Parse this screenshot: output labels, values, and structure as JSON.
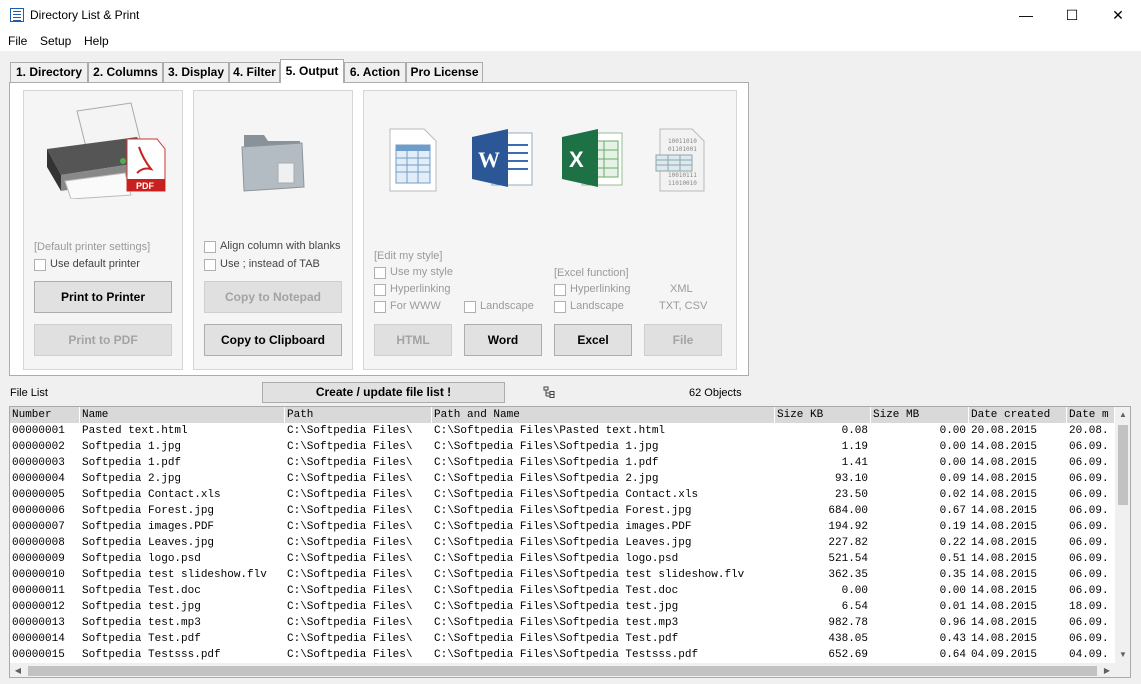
{
  "window": {
    "title": "Directory List & Print"
  },
  "menu": [
    "File",
    "Setup",
    "Help"
  ],
  "tabs": [
    "1. Directory",
    "2. Columns",
    "3. Display",
    "4. Filter",
    "5. Output",
    "6. Action",
    "Pro License"
  ],
  "active_tab": 4,
  "print_group": {
    "settings_label": "[Default printer settings]",
    "use_default_printer": "Use default printer",
    "print_button": "Print to Printer",
    "pdf_button": "Print to PDF"
  },
  "clipboard_group": {
    "align_blanks": "Align column with blanks",
    "use_tab": "Use  ;  instead of TAB",
    "notepad_button": "Copy to Notepad",
    "clipboard_button": "Copy to Clipboard"
  },
  "export_group": {
    "edit_style": "[Edit my style]",
    "use_my_style": "Use my style",
    "hyperlinking": "Hyperlinking",
    "for_www": "For WWW",
    "landscape_word": "Landscape",
    "excel_function": "[Excel function]",
    "excel_hyperlinking": "Hyperlinking",
    "excel_landscape": "Landscape",
    "xml": "XML",
    "txt_csv": "TXT, CSV",
    "html_button": "HTML",
    "word_button": "Word",
    "excel_button": "Excel",
    "file_button": "File"
  },
  "file_list": {
    "label": "File List",
    "create_button": "Create / update file list !",
    "object_count": "62 Objects"
  },
  "grid": {
    "columns": [
      "Number",
      "Name",
      "Path",
      "Path and Name",
      "Size KB",
      "Size MB",
      "Date created",
      "Date m"
    ],
    "rows": [
      [
        "00000001",
        "Pasted text.html",
        "C:\\Softpedia Files\\",
        "C:\\Softpedia Files\\Pasted text.html",
        "0.08",
        "0.00",
        "20.08.2015",
        "20.08."
      ],
      [
        "00000002",
        "Softpedia 1.jpg",
        "C:\\Softpedia Files\\",
        "C:\\Softpedia Files\\Softpedia 1.jpg",
        "1.19",
        "0.00",
        "14.08.2015",
        "06.09."
      ],
      [
        "00000003",
        "Softpedia 1.pdf",
        "C:\\Softpedia Files\\",
        "C:\\Softpedia Files\\Softpedia 1.pdf",
        "1.41",
        "0.00",
        "14.08.2015",
        "06.09."
      ],
      [
        "00000004",
        "Softpedia 2.jpg",
        "C:\\Softpedia Files\\",
        "C:\\Softpedia Files\\Softpedia 2.jpg",
        "93.10",
        "0.09",
        "14.08.2015",
        "06.09."
      ],
      [
        "00000005",
        "Softpedia Contact.xls",
        "C:\\Softpedia Files\\",
        "C:\\Softpedia Files\\Softpedia Contact.xls",
        "23.50",
        "0.02",
        "14.08.2015",
        "06.09."
      ],
      [
        "00000006",
        "Softpedia Forest.jpg",
        "C:\\Softpedia Files\\",
        "C:\\Softpedia Files\\Softpedia Forest.jpg",
        "684.00",
        "0.67",
        "14.08.2015",
        "06.09."
      ],
      [
        "00000007",
        "Softpedia images.PDF",
        "C:\\Softpedia Files\\",
        "C:\\Softpedia Files\\Softpedia images.PDF",
        "194.92",
        "0.19",
        "14.08.2015",
        "06.09."
      ],
      [
        "00000008",
        "Softpedia Leaves.jpg",
        "C:\\Softpedia Files\\",
        "C:\\Softpedia Files\\Softpedia Leaves.jpg",
        "227.82",
        "0.22",
        "14.08.2015",
        "06.09."
      ],
      [
        "00000009",
        "Softpedia logo.psd",
        "C:\\Softpedia Files\\",
        "C:\\Softpedia Files\\Softpedia logo.psd",
        "521.54",
        "0.51",
        "14.08.2015",
        "06.09."
      ],
      [
        "00000010",
        "Softpedia test slideshow.flv",
        "C:\\Softpedia Files\\",
        "C:\\Softpedia Files\\Softpedia test slideshow.flv",
        "362.35",
        "0.35",
        "14.08.2015",
        "06.09."
      ],
      [
        "00000011",
        "Softpedia Test.doc",
        "C:\\Softpedia Files\\",
        "C:\\Softpedia Files\\Softpedia Test.doc",
        "0.00",
        "0.00",
        "14.08.2015",
        "06.09."
      ],
      [
        "00000012",
        "Softpedia test.jpg",
        "C:\\Softpedia Files\\",
        "C:\\Softpedia Files\\Softpedia test.jpg",
        "6.54",
        "0.01",
        "14.08.2015",
        "18.09."
      ],
      [
        "00000013",
        "Softpedia test.mp3",
        "C:\\Softpedia Files\\",
        "C:\\Softpedia Files\\Softpedia test.mp3",
        "982.78",
        "0.96",
        "14.08.2015",
        "06.09."
      ],
      [
        "00000014",
        "Softpedia Test.pdf",
        "C:\\Softpedia Files\\",
        "C:\\Softpedia Files\\Softpedia Test.pdf",
        "438.05",
        "0.43",
        "14.08.2015",
        "06.09."
      ],
      [
        "00000015",
        "Softpedia Testsss.pdf",
        "C:\\Softpedia Files\\",
        "C:\\Softpedia Files\\Softpedia Testsss.pdf",
        "652.69",
        "0.64",
        "04.09.2015",
        "04.09."
      ]
    ]
  }
}
